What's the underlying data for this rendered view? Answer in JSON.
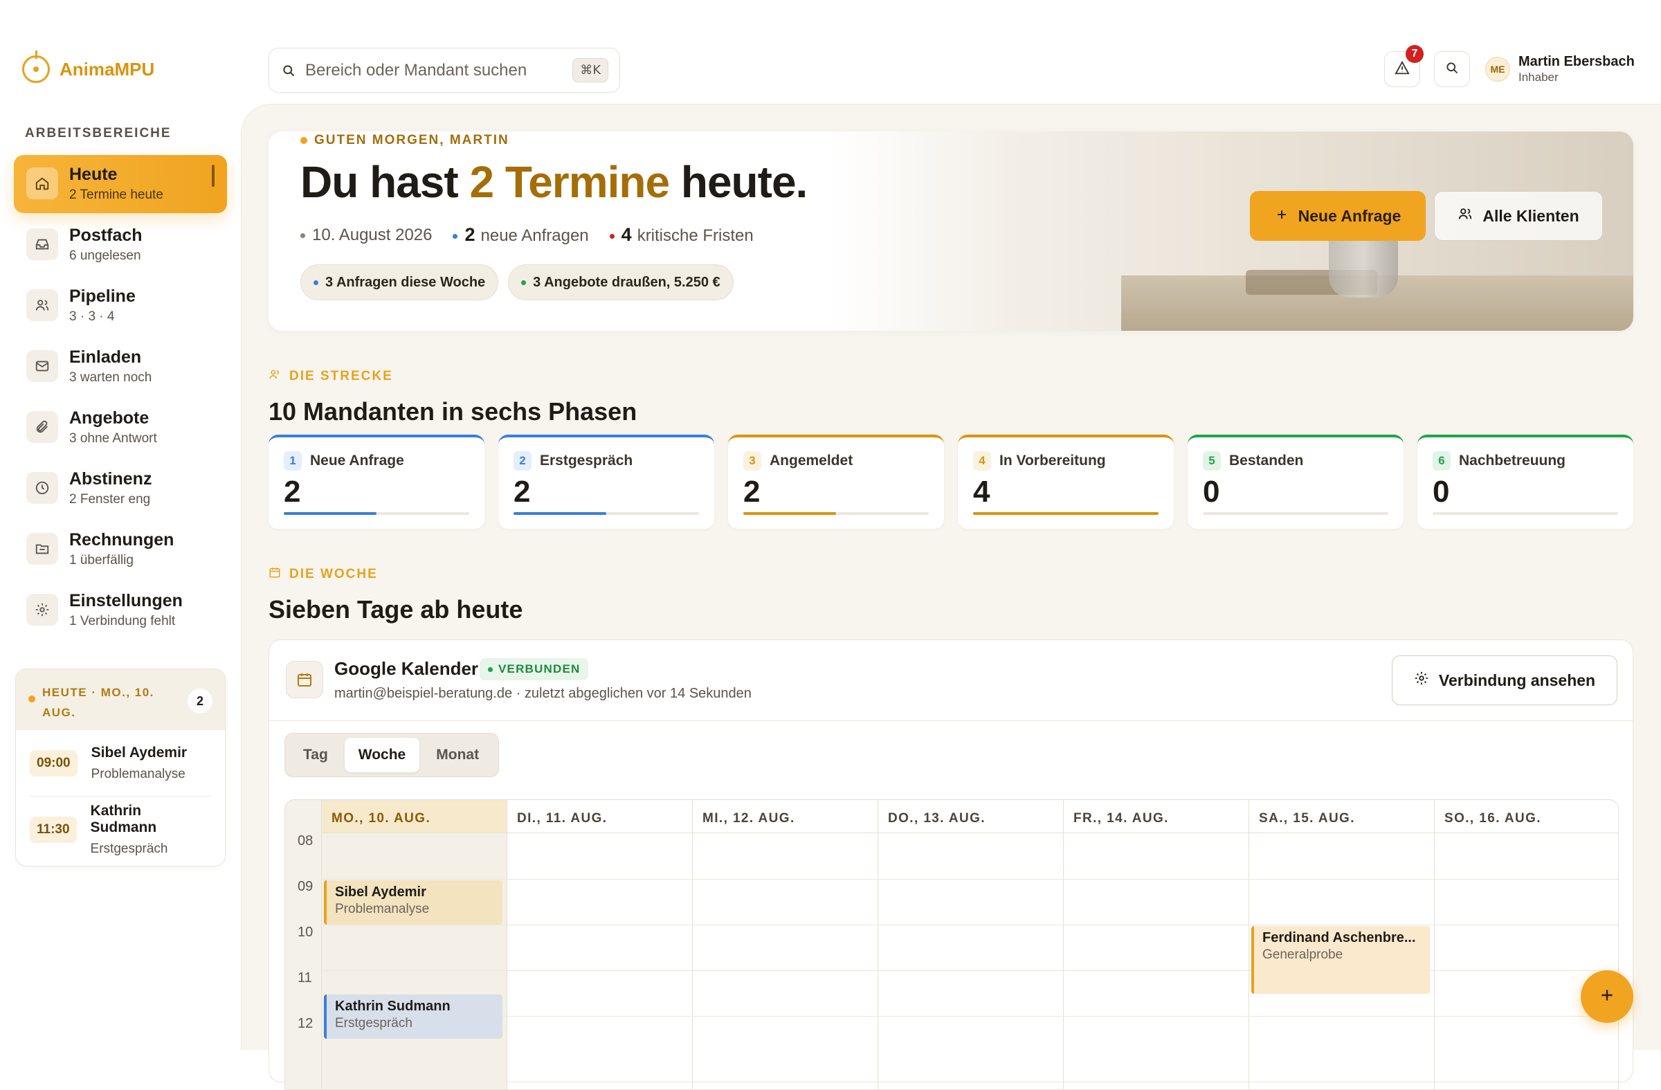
{
  "app": {
    "name": "AnimaMPU"
  },
  "sidebar": {
    "section_label": "ARBEITSBEREICHE",
    "items": [
      {
        "label": "Heute",
        "sub": "2 Termine heute",
        "icon": "home-icon",
        "active": true
      },
      {
        "label": "Postfach",
        "sub": "6 ungelesen",
        "icon": "inbox-icon"
      },
      {
        "label": "Pipeline",
        "sub": "3 · 3 · 4",
        "icon": "users-icon"
      },
      {
        "label": "Einladen",
        "sub": "3 warten noch",
        "icon": "mail-icon"
      },
      {
        "label": "Angebote",
        "sub": "3 ohne Antwort",
        "icon": "paperclip-icon"
      },
      {
        "label": "Abstinenz",
        "sub": "2 Fenster eng",
        "icon": "clock-icon"
      },
      {
        "label": "Rechnungen",
        "sub": "1 überfällig",
        "icon": "folder-icon"
      },
      {
        "label": "Einstellungen",
        "sub": "1 Verbindung fehlt",
        "icon": "gear-icon"
      }
    ],
    "today_card": {
      "header": "HEUTE · MO., 10. AUG.",
      "count": "2",
      "entries": [
        {
          "time": "09:00",
          "name": "Sibel Aydemir",
          "sub": "Problemanalyse"
        },
        {
          "time": "11:30",
          "name": "Kathrin Sudmann",
          "sub": "Erstgespräch"
        }
      ]
    }
  },
  "topbar": {
    "search_placeholder": "Bereich oder Mandant suchen",
    "shortcut": "⌘K",
    "alert_count": "7",
    "user": {
      "initials": "ME",
      "name": "Martin Ebersbach",
      "role": "Inhaber"
    }
  },
  "hero": {
    "greeting": "GUTEN MORGEN, MARTIN",
    "title_pre": "Du hast ",
    "title_accent": "2 Termine",
    "title_post": " heute.",
    "date": "10. August 2026",
    "new_requests_count": "2",
    "new_requests_label": "neue Anfragen",
    "deadlines_count": "4",
    "deadlines_label": "kritische Fristen",
    "pills": [
      "3 Anfragen diese Woche",
      "3 Angebote draußen, 5.250 €"
    ],
    "primary_button": "Neue Anfrage",
    "secondary_button": "Alle Klienten"
  },
  "pipeline": {
    "eyebrow": "DIE STRECKE",
    "title": "10 Mandanten in sechs Phasen",
    "phases": [
      {
        "num": "1",
        "label": "Neue Anfrage",
        "value": "2",
        "fill": 0.5,
        "color": "#3a7fd9"
      },
      {
        "num": "2",
        "label": "Erstgespräch",
        "value": "2",
        "fill": 0.5,
        "color": "#3a7fd9"
      },
      {
        "num": "3",
        "label": "Angemeldet",
        "value": "2",
        "fill": 0.5,
        "color": "#d9940e"
      },
      {
        "num": "4",
        "label": "In Vorbereitung",
        "value": "4",
        "fill": 1.0,
        "color": "#d9940e"
      },
      {
        "num": "5",
        "label": "Bestanden",
        "value": "0",
        "fill": 0,
        "color": "#22a34a"
      },
      {
        "num": "6",
        "label": "Nachbetreuung",
        "value": "0",
        "fill": 0,
        "color": "#22a34a"
      }
    ]
  },
  "week": {
    "eyebrow": "DIE WOCHE",
    "title": "Sieben Tage ab heute",
    "calendar": {
      "title": "Google Kalender",
      "status": "VERBUNDEN",
      "subtitle": "martin@beispiel-beratung.de · zuletzt abgeglichen vor 14 Sekunden",
      "connection_button": "Verbindung ansehen",
      "views": [
        "Tag",
        "Woche",
        "Monat"
      ],
      "active_view": "Woche",
      "days": [
        "MO., 10. AUG.",
        "DI., 11. AUG.",
        "MI., 12. AUG.",
        "DO., 13. AUG.",
        "FR., 14. AUG.",
        "SA., 15. AUG.",
        "SO., 16. AUG."
      ],
      "hours": [
        "08",
        "09",
        "10",
        "11",
        "12"
      ],
      "events": [
        {
          "name": "Sibel Aydemir",
          "sub": "Problemanalyse"
        },
        {
          "name": "Kathrin Sudmann",
          "sub": "Erstgespräch"
        },
        {
          "name": "Ferdinand Aschenbre...",
          "sub": "Generalprobe"
        }
      ]
    }
  }
}
